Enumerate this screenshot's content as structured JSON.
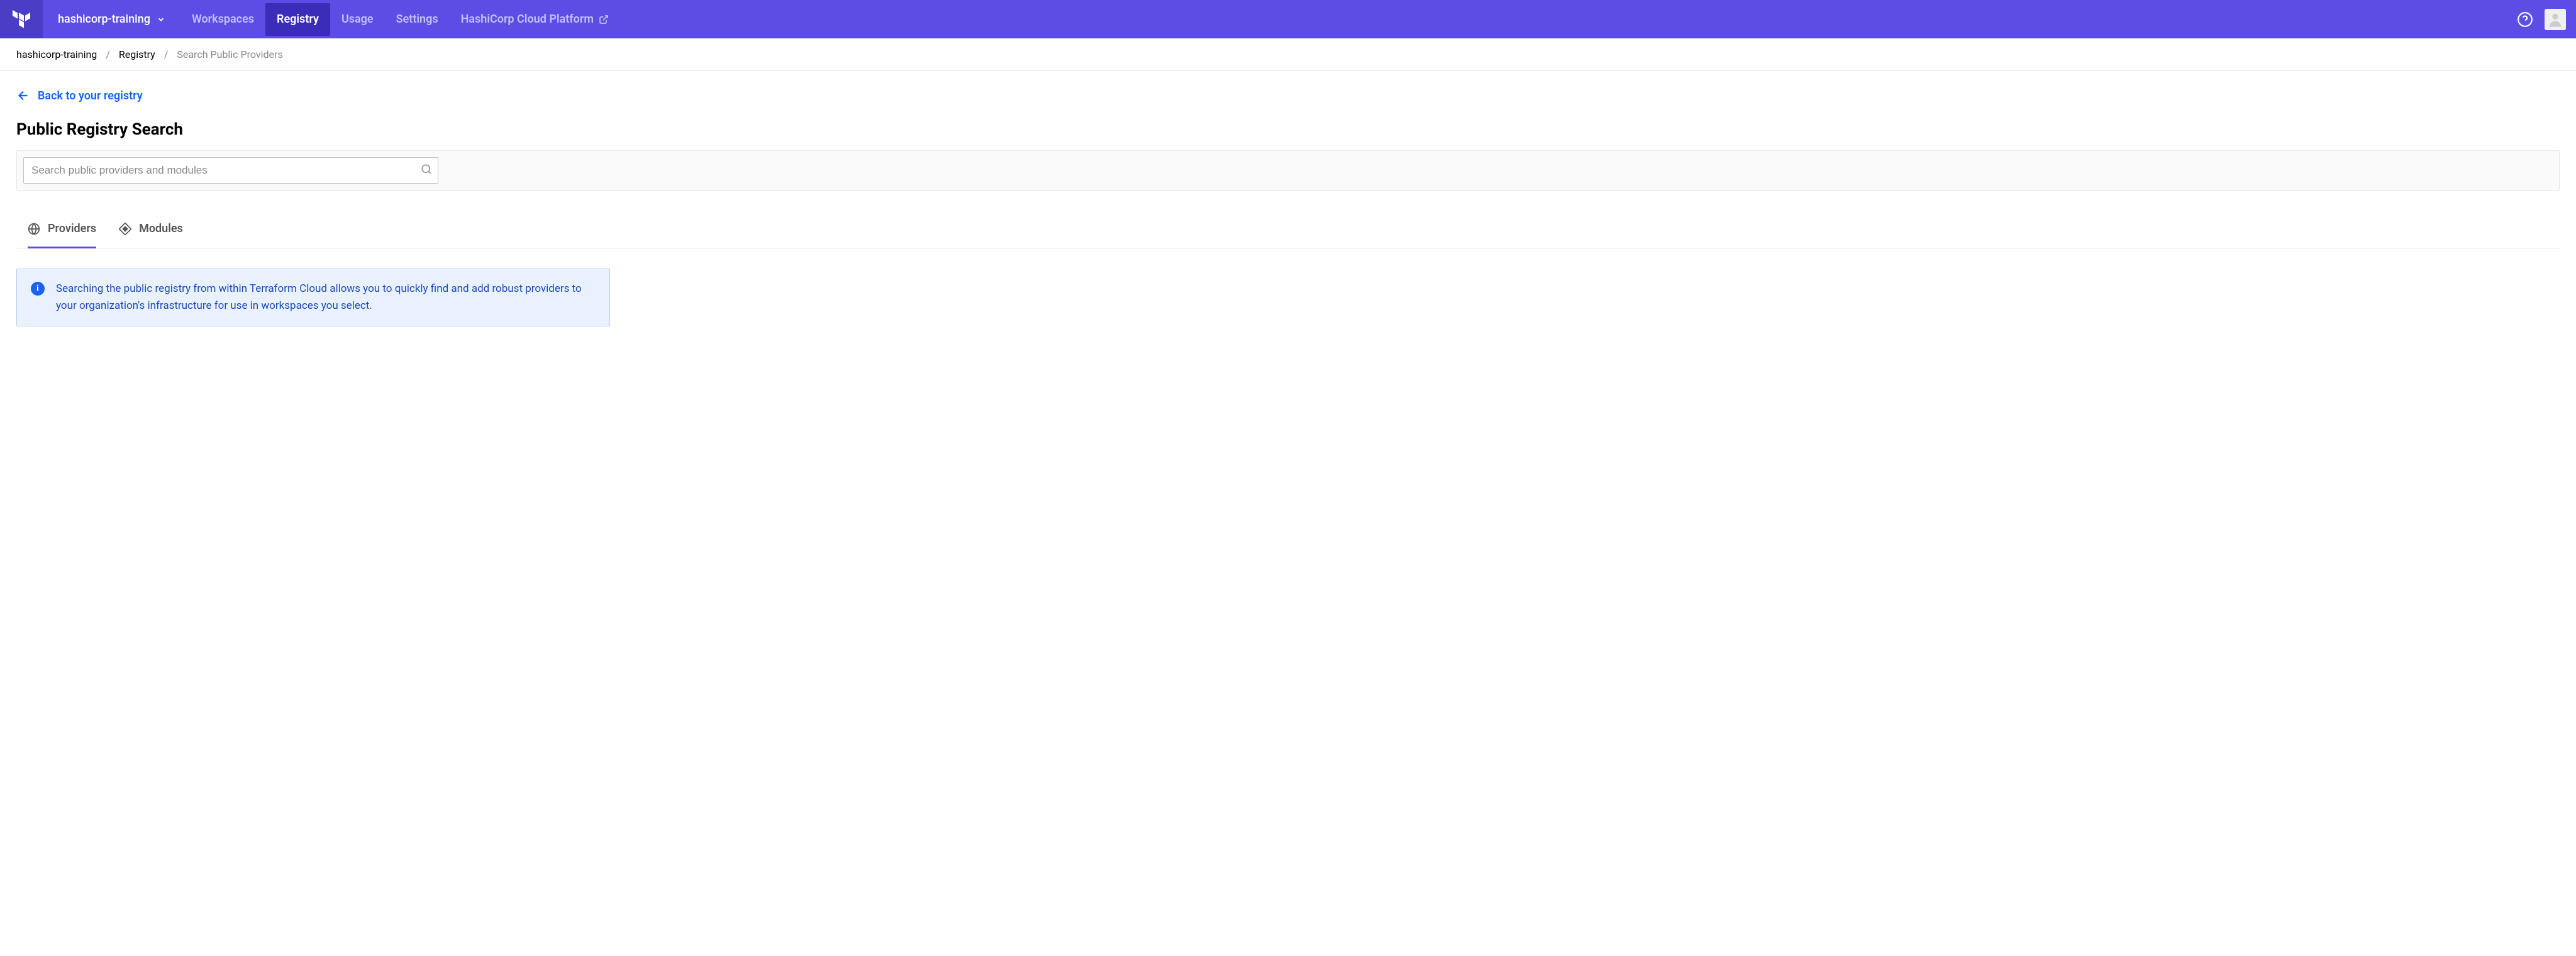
{
  "header": {
    "org_name": "hashicorp-training",
    "nav": [
      {
        "label": "Workspaces",
        "active": false
      },
      {
        "label": "Registry",
        "active": true
      },
      {
        "label": "Usage",
        "active": false
      },
      {
        "label": "Settings",
        "active": false
      },
      {
        "label": "HashiCorp Cloud Platform",
        "active": false,
        "external": true
      }
    ]
  },
  "breadcrumb": {
    "items": [
      {
        "label": "hashicorp-training",
        "current": false
      },
      {
        "label": "Registry",
        "current": false
      },
      {
        "label": "Search Public Providers",
        "current": true
      }
    ]
  },
  "back_link": "Back to your registry",
  "page_title": "Public Registry Search",
  "search": {
    "placeholder": "Search public providers and modules"
  },
  "tabs": [
    {
      "label": "Providers",
      "active": true
    },
    {
      "label": "Modules",
      "active": false
    }
  ],
  "info": {
    "text": "Searching the public registry from within Terraform Cloud allows you to quickly find and add robust providers to your organization's infrastructure for use in workspaces you select."
  }
}
